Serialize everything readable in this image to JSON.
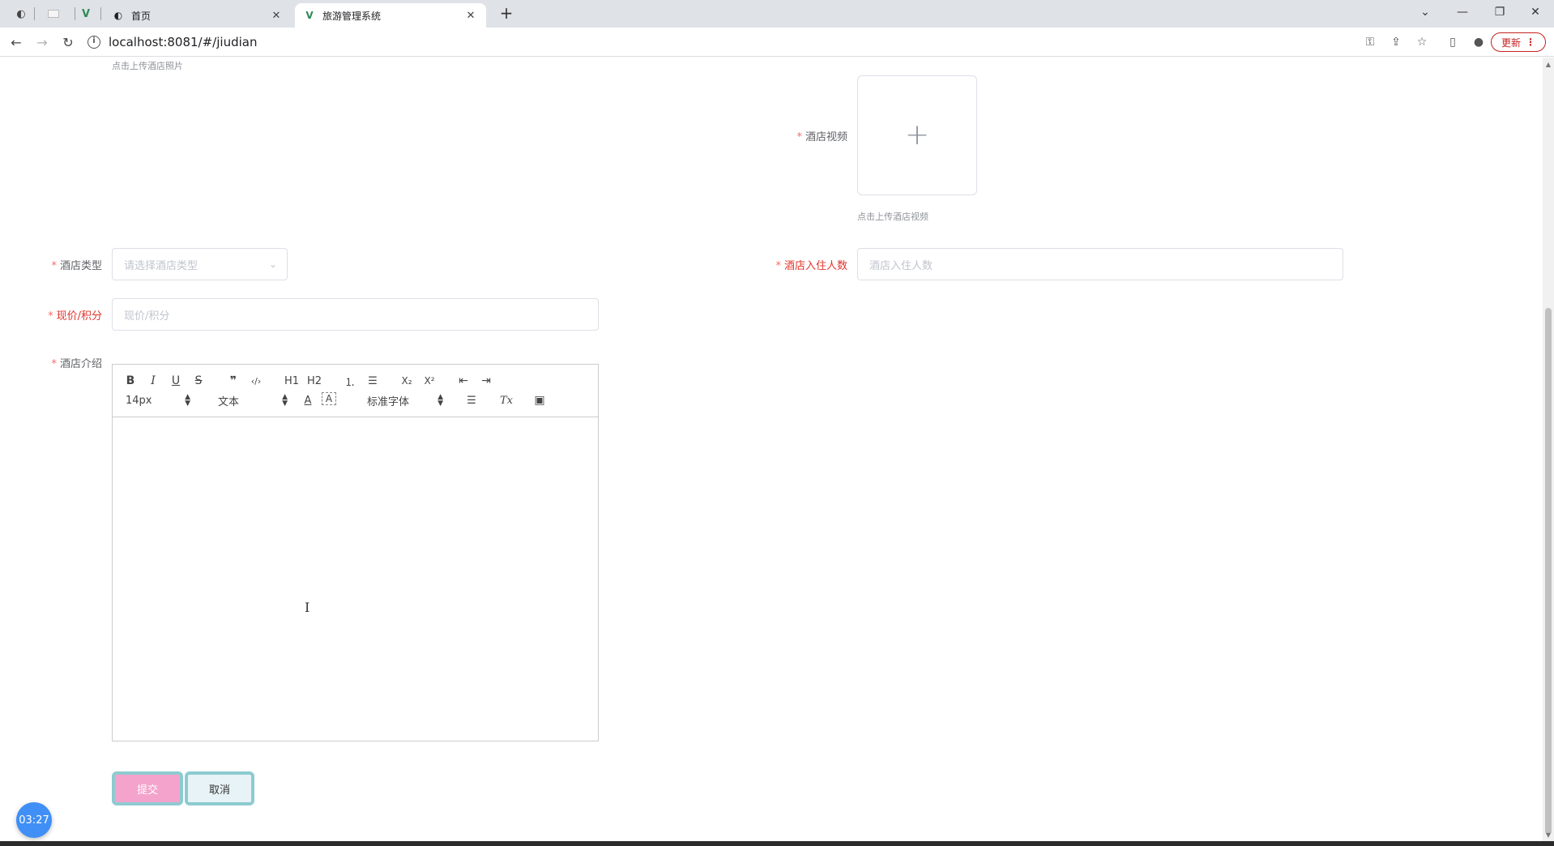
{
  "browser": {
    "tabs": [
      {
        "title": "首页",
        "icon": "globe-icon"
      },
      {
        "title": "旅游管理系统",
        "icon": "vue-logo-icon",
        "active": true
      }
    ],
    "url": "localhost:8081/#/jiudian",
    "update_label": "更新"
  },
  "form": {
    "photo_hint": "点击上传酒店照片",
    "video_label": "酒店视频",
    "video_hint": "点击上传酒店视频",
    "type_label": "酒店类型",
    "type_placeholder": "请选择酒店类型",
    "capacity_label": "酒店入住人数",
    "capacity_placeholder": "酒店入住人数",
    "price_label": "现价/积分",
    "price_placeholder": "现价/积分",
    "intro_label": "酒店介绍",
    "required_mark": "*"
  },
  "editor": {
    "size_value": "14px",
    "header_value": "文本",
    "font_value": "标准字体",
    "buttons": {
      "bold": "B",
      "italic": "I",
      "underline": "U",
      "strike": "S",
      "quote": "❞",
      "code": "‹/›",
      "h1": "H1",
      "h2": "H2",
      "ordered": "⒈",
      "bullet": "☰",
      "sub": "X₂",
      "sup": "X²",
      "outdent": "⇤",
      "indent": "⇥",
      "color": "A",
      "background": "A",
      "align": "☰",
      "clean": "Tx",
      "image": "▣"
    }
  },
  "actions": {
    "submit_label": "提交",
    "cancel_label": "取消"
  },
  "timer": {
    "value": "03:27"
  },
  "colors": {
    "required": "#f56c6c",
    "submit_bg": "#f4a3cc",
    "button_border": "#8dcbd0",
    "timer_bg": "#3f8ff7"
  }
}
